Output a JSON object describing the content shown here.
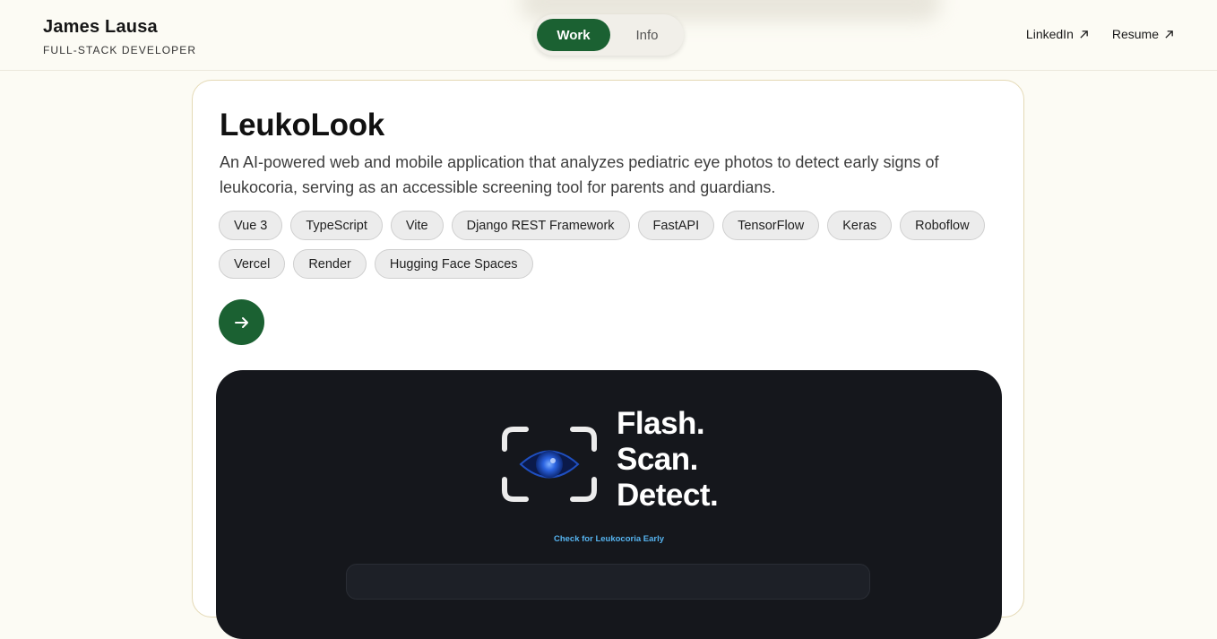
{
  "header": {
    "name": "James Lausa",
    "role": "FULL-STACK DEVELOPER",
    "toggle": {
      "work": "Work",
      "info": "Info",
      "active": "Work"
    },
    "links": [
      {
        "label": "LinkedIn",
        "icon": "arrow-up-right-icon"
      },
      {
        "label": "Resume",
        "icon": "arrow-up-right-icon"
      }
    ]
  },
  "project": {
    "title": "LeukoLook",
    "description": "An AI-powered web and mobile application that analyzes pediatric eye photos to detect early signs of leukocoria, serving as an accessible screening tool for parents and guardians.",
    "tags": [
      "Vue 3",
      "TypeScript",
      "Vite",
      "Django REST Framework",
      "FastAPI",
      "TensorFlow",
      "Keras",
      "Roboflow",
      "Vercel",
      "Render",
      "Hugging Face Spaces"
    ],
    "open_icon": "arrow-right-icon",
    "preview": {
      "slogan": [
        "Flash.",
        "Scan.",
        "Detect."
      ],
      "tagline": "Check for Leukocoria Early",
      "logo_icon": "eye-scan-icon"
    }
  },
  "colors": {
    "background": "#fcfbf4",
    "accent": "#1b6132",
    "card_border": "#e4d9b5",
    "preview_bg": "#15171c",
    "tagline": "#56b4f0"
  }
}
